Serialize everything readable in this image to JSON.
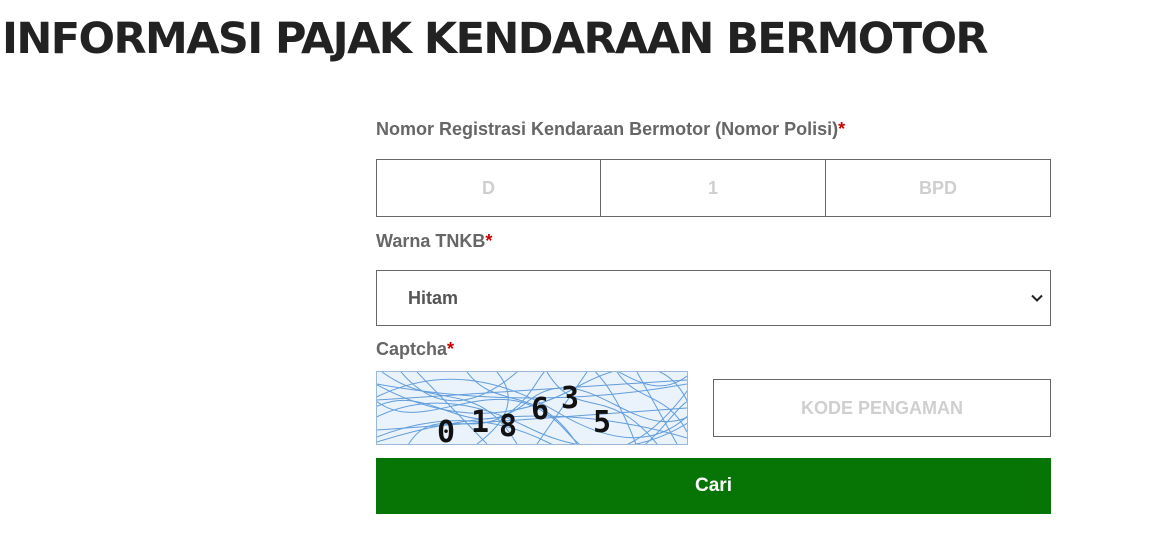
{
  "page": {
    "title": "INFORMASI PAJAK KENDARAAN BERMOTOR"
  },
  "form": {
    "plate": {
      "label": "Nomor Registrasi Kendaraan Bermotor (Nomor Polisi)",
      "required_mark": "*",
      "prefix": {
        "value": "",
        "placeholder": "D"
      },
      "number": {
        "value": "",
        "placeholder": "1"
      },
      "suffix": {
        "value": "",
        "placeholder": "BPD"
      }
    },
    "plate_color": {
      "label": "Warna TNKB",
      "required_mark": "*",
      "selected": "Hitam"
    },
    "captcha": {
      "label": "Captcha",
      "required_mark": "*",
      "digits": [
        "0",
        "1",
        "8",
        "6",
        "3",
        "5"
      ],
      "code_input": {
        "value": "",
        "placeholder": "KODE PENGAMAN"
      }
    },
    "submit_label": "Cari"
  },
  "colors": {
    "title": "#222222",
    "label": "#666666",
    "required": "#cc0000",
    "button_bg": "#067506",
    "button_text": "#ffffff",
    "captcha_lines": "#4a8fd6"
  },
  "icons": {
    "select_arrow": "chevron-down-icon"
  }
}
